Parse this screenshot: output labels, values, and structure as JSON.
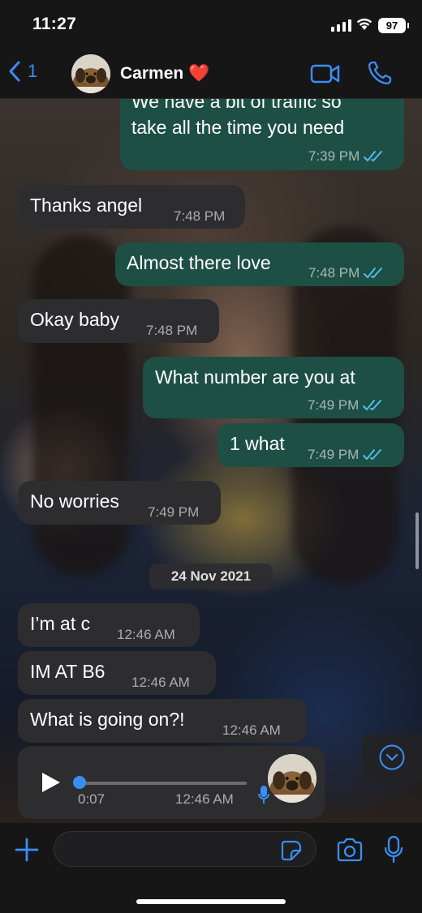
{
  "status_bar": {
    "time": "11:27",
    "battery": "97"
  },
  "nav": {
    "back_count": "1",
    "contact_name": "Carmen ❤️"
  },
  "messages": [
    {
      "direction": "out",
      "text_lines": [
        "We have a bit of traffic so",
        "take all the time you need"
      ],
      "time": "7:39 PM",
      "read": true
    },
    {
      "direction": "in",
      "text": "Thanks angel",
      "time": "7:48 PM"
    },
    {
      "direction": "out",
      "text": "Almost there love",
      "time": "7:48 PM",
      "read": true
    },
    {
      "direction": "in",
      "text": "Okay baby",
      "time": "7:48 PM"
    },
    {
      "direction": "out",
      "text": "What number are you at",
      "time": "7:49 PM",
      "read": true
    },
    {
      "direction": "out",
      "text": "1 what",
      "time": "7:49 PM",
      "read": true
    },
    {
      "direction": "in",
      "text": "No worries",
      "time": "7:49 PM"
    },
    {
      "direction": "in",
      "text": "I’m at c",
      "time": "12:46 AM"
    },
    {
      "direction": "in",
      "text": "IM AT B6",
      "time": "12:46 AM"
    },
    {
      "direction": "in",
      "text": "What is going on?!",
      "time": "12:46 AM"
    }
  ],
  "date_separator": "24 Nov 2021",
  "voice_message": {
    "duration": "0:07",
    "time": "12:46 AM",
    "progress": 0
  },
  "colors": {
    "accent": "#3b8df6",
    "outgoing_bubble": "#1d4f45",
    "incoming_bubble": "#2d2d2f",
    "read_tick": "#53bdeb"
  },
  "icons": {
    "back": "chevron-left-icon",
    "video": "video-camera-icon",
    "call": "phone-icon",
    "play": "play-icon",
    "mic": "microphone-icon",
    "scroll_down": "chevron-down-circle-icon",
    "plus": "plus-icon",
    "sticker": "sticker-icon",
    "camera": "camera-icon"
  }
}
